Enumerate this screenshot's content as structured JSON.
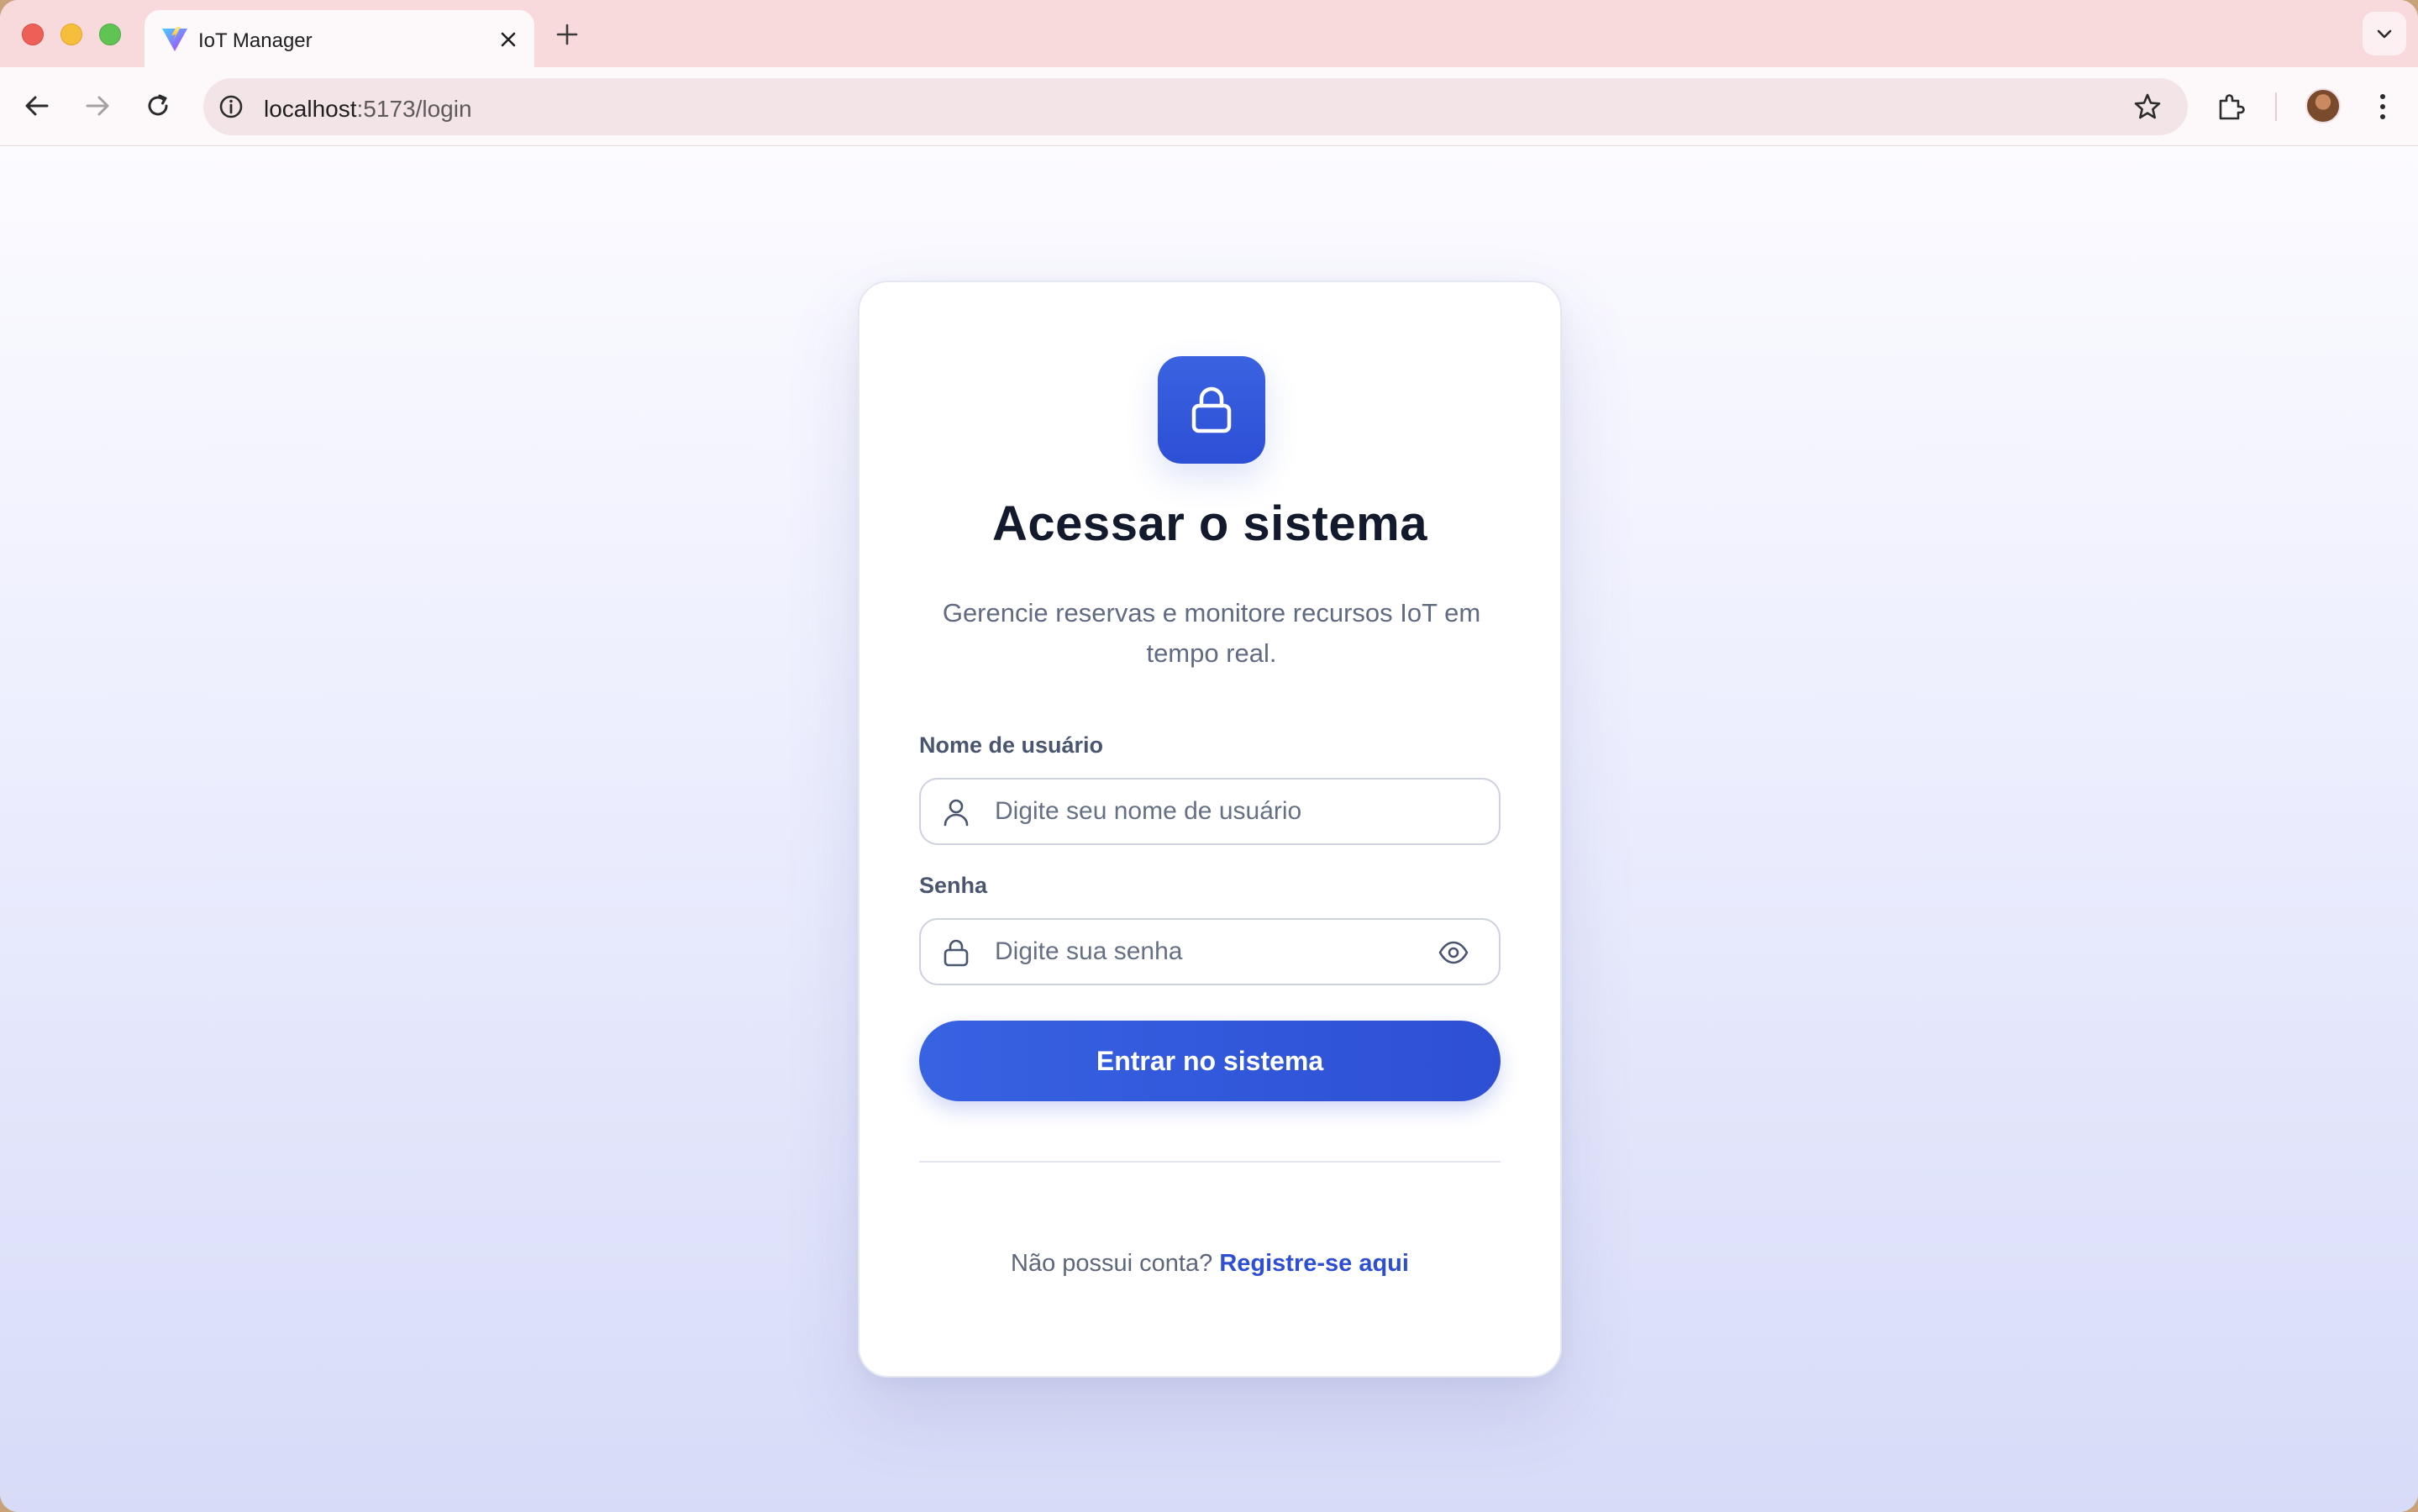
{
  "browser": {
    "tab": {
      "title": "IoT Manager",
      "favicon": "vite-logo-icon"
    },
    "address_bar": {
      "host": "localhost",
      "path": ":5173/login"
    },
    "icons": [
      "back-arrow-icon",
      "forward-arrow-icon",
      "reload-icon",
      "site-info-icon",
      "bookmark-star-icon",
      "extensions-icon",
      "profile-avatar",
      "more-menu-icon",
      "new-tab-icon",
      "tab-close-icon",
      "tab-search-icon"
    ]
  },
  "login": {
    "title": "Acessar o sistema",
    "subtitle": "Gerencie reservas e monitore recursos IoT em tempo real.",
    "username": {
      "label": "Nome de usuário",
      "placeholder": "Digite seu nome de usuário",
      "value": "",
      "icon": "user-icon"
    },
    "password": {
      "label": "Senha",
      "placeholder": "Digite sua senha",
      "value": "",
      "icon": "lock-icon",
      "toggle_icon": "eye-icon"
    },
    "submit_label": "Entrar no sistema",
    "footer_prompt": "Não possui conta?",
    "register_link": "Registre-se aqui"
  },
  "colors": {
    "primary": "#2e4fd4",
    "heading": "#141a2e",
    "muted_text": "#606b83",
    "tabstrip": "#f8d9dc"
  }
}
